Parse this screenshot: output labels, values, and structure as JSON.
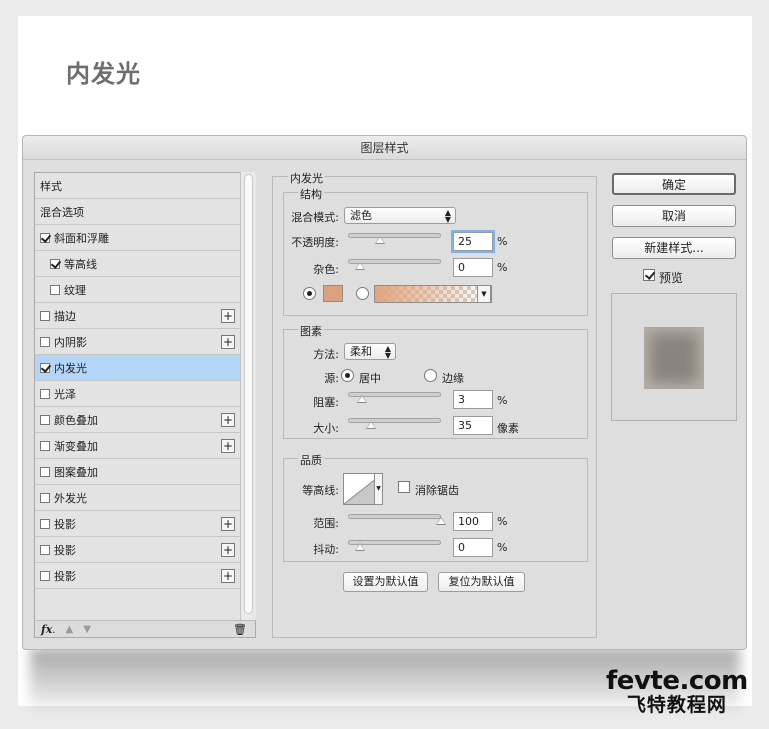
{
  "page": {
    "title": "内发光"
  },
  "dialog": {
    "title": "图层样式",
    "styles_header": "样式",
    "blend_options": "混合选项",
    "style_items": [
      {
        "label": "斜面和浮雕",
        "checked": true,
        "indent": false,
        "plus": false,
        "selected": false
      },
      {
        "label": "等高线",
        "checked": true,
        "indent": true,
        "plus": false,
        "selected": false
      },
      {
        "label": "纹理",
        "checked": false,
        "indent": true,
        "plus": false,
        "selected": false
      },
      {
        "label": "描边",
        "checked": false,
        "indent": false,
        "plus": true,
        "selected": false
      },
      {
        "label": "内阴影",
        "checked": false,
        "indent": false,
        "plus": true,
        "selected": false
      },
      {
        "label": "内发光",
        "checked": true,
        "indent": false,
        "plus": false,
        "selected": true
      },
      {
        "label": "光泽",
        "checked": false,
        "indent": false,
        "plus": false,
        "selected": false
      },
      {
        "label": "颜色叠加",
        "checked": false,
        "indent": false,
        "plus": true,
        "selected": false
      },
      {
        "label": "渐变叠加",
        "checked": false,
        "indent": false,
        "plus": true,
        "selected": false
      },
      {
        "label": "图案叠加",
        "checked": false,
        "indent": false,
        "plus": false,
        "selected": false
      },
      {
        "label": "外发光",
        "checked": false,
        "indent": false,
        "plus": false,
        "selected": false
      },
      {
        "label": "投影",
        "checked": false,
        "indent": false,
        "plus": true,
        "selected": false
      },
      {
        "label": "投影",
        "checked": false,
        "indent": false,
        "plus": true,
        "selected": false
      },
      {
        "label": "投影",
        "checked": false,
        "indent": false,
        "plus": true,
        "selected": false
      }
    ],
    "footer": {
      "fx": "fx",
      "fx_sub": "."
    },
    "inner_glow": {
      "group_title": "内发光",
      "structure": {
        "title": "结构",
        "blend_mode_label": "混合模式:",
        "blend_mode_value": "滤色",
        "opacity_label": "不透明度:",
        "opacity_value": "25",
        "opacity_unit": "%",
        "opacity_level": 25,
        "noise_label": "杂色:",
        "noise_value": "0",
        "noise_unit": "%",
        "noise_level": 0,
        "glow_color": "#d9a27c"
      },
      "elements": {
        "title": "图素",
        "technique_label": "方法:",
        "technique_value": "柔和",
        "source_label": "源:",
        "source_center": "居中",
        "source_edge": "边缘",
        "choke_label": "阻塞:",
        "choke_value": "3",
        "choke_unit": "%",
        "choke_level": 3,
        "size_label": "大小:",
        "size_value": "35",
        "size_unit": "像素",
        "size_level": 14
      },
      "quality": {
        "title": "品质",
        "contour_label": "等高线:",
        "antialias_label": "消除锯齿",
        "range_label": "范围:",
        "range_value": "100",
        "range_unit": "%",
        "range_level": 100,
        "jitter_label": "抖动:",
        "jitter_value": "0",
        "jitter_unit": "%",
        "jitter_level": 0
      },
      "make_default": "设置为默认值",
      "reset_default": "复位为默认值"
    },
    "buttons": {
      "ok": "确定",
      "cancel": "取消",
      "new_style": "新建样式...",
      "preview": "预览"
    }
  },
  "watermark": {
    "top": "fevte.com",
    "bottom": "飞特教程网"
  }
}
